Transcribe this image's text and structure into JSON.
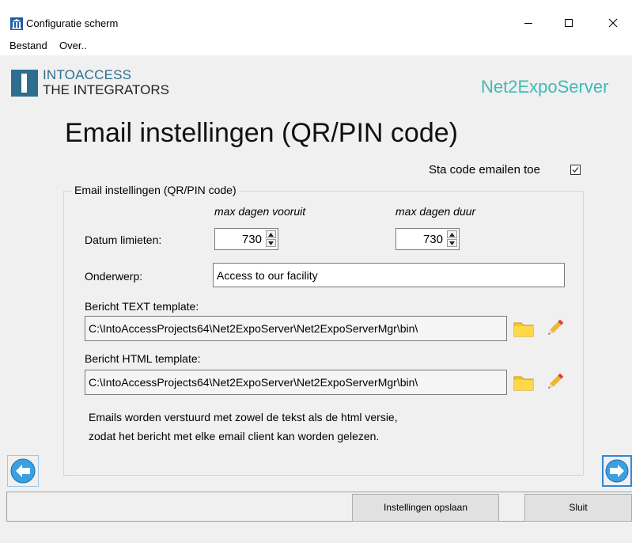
{
  "window": {
    "title": "Configuratie scherm",
    "icon": "building-icon",
    "controls": {
      "minimize": "minimize-icon",
      "maximize": "maximize-icon",
      "close": "close-icon"
    }
  },
  "menu": {
    "items": [
      "Bestand",
      "Over.."
    ]
  },
  "header": {
    "logo_line1": "INTOACCESS",
    "logo_line2": "THE INTEGRATORS",
    "product": "Net2ExpoServer"
  },
  "page": {
    "title": "Email instellingen (QR/PIN code)",
    "allow_label": "Sta code emailen toe",
    "allow_checked": true
  },
  "group": {
    "legend": "Email instellingen (QR/PIN code)",
    "col_head_1": "max dagen vooruit",
    "col_head_2": "max dagen duur",
    "date_label": "Datum limieten:",
    "days_ahead": "730",
    "days_duration": "730",
    "subject_label": "Onderwerp:",
    "subject_value": "Access to our facility",
    "text_label": "Bericht TEXT template:",
    "text_path": "C:\\IntoAccessProjects64\\Net2ExpoServer\\Net2ExpoServerMgr\\bin\\",
    "html_label": "Bericht HTML template:",
    "html_path": "C:\\IntoAccessProjects64\\Net2ExpoServer\\Net2ExpoServerMgr\\bin\\",
    "info_line1": "Emails worden verstuurd met zowel de tekst als de html versie,",
    "info_line2": "zodat het bericht met elke email client kan worden gelezen."
  },
  "footer": {
    "save_label": "Instellingen opslaan",
    "close_label": "Sluit"
  },
  "colors": {
    "brand_teal": "#3fb9b6",
    "logo_blue": "#2e6e8e",
    "nav_blue": "#2f86d6",
    "folder_yellow": "#f6c928"
  }
}
